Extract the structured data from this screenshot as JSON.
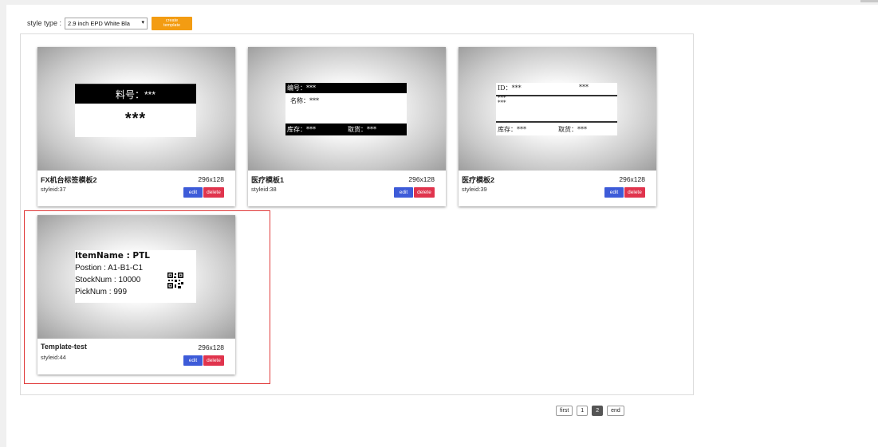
{
  "toolbar": {
    "style_type_label": "style type :",
    "style_select_value": "2.9 inch EPD White Bla",
    "create_line1": "create",
    "create_line2": "template"
  },
  "cards": [
    {
      "name": "FX机台标签模板2",
      "size": "296x128",
      "styleid": "styleid:37",
      "edit": "edit",
      "delete": "delete",
      "preview": {
        "line1": "料号：***",
        "line2": "***"
      }
    },
    {
      "name": "医疗模板1",
      "size": "296x128",
      "styleid": "styleid:38",
      "edit": "edit",
      "delete": "delete",
      "preview": {
        "line1": "编号：***",
        "line2": "名称：***",
        "line3a": "库存：***",
        "line3b": "取货：***"
      }
    },
    {
      "name": "医疗模板2",
      "size": "296x128",
      "styleid": "styleid:39",
      "edit": "edit",
      "delete": "delete",
      "preview": {
        "line1a": "ID：***",
        "line1b": "***",
        "line2": "***",
        "line3": "***",
        "line4a": "库存：***",
        "line4b": "取货：***"
      }
    },
    {
      "name": "Template-test",
      "size": "296x128",
      "styleid": "styleid:44",
      "edit": "edit",
      "delete": "delete",
      "preview": {
        "line1": "ItemName : PTL",
        "line2": "Postion : A1-B1-C1",
        "line3": "StockNum : 10000",
        "line4": "PickNum :  999"
      }
    }
  ],
  "pagination": {
    "first": "first",
    "p1": "1",
    "p2": "2",
    "end": "end",
    "current_page": 2
  },
  "colors": {
    "accent": "#f39c12",
    "edit": "#3d5bd8",
    "delete": "#e0344d",
    "selection": "#e03a3a"
  }
}
